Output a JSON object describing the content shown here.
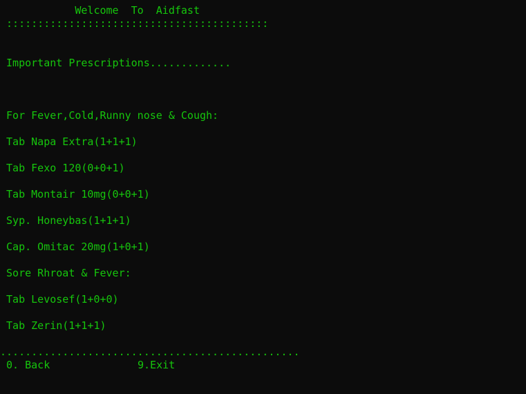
{
  "terminal": {
    "header": {
      "title": "            Welcome  To  Aidfast",
      "separator": " ::::::::::::::::::::::::::::::::::::::::::"
    },
    "section_title": " Important Prescriptions.............",
    "groups": [
      {
        "heading": " For Fever,Cold,Runny nose & Cough:",
        "items": [
          " Tab Napa Extra(1+1+1)",
          " Tab Fexo 120(0+0+1)",
          " Tab Montair 10mg(0+0+1)",
          " Syp. Honeybas(1+1+1)",
          " Cap. Omitac 20mg(1+0+1)"
        ]
      },
      {
        "heading": " Sore Rhroat & Fever:",
        "items": [
          " Tab Levosef(1+0+0)",
          " Tab Zerin(1+1+1)"
        ]
      }
    ],
    "footer": {
      "separator": "................................................",
      "back_label": " 0. Back",
      "exit_label": "9.Exit"
    },
    "colors": {
      "background": "#0c0c0c",
      "text": "#16c60c"
    }
  }
}
